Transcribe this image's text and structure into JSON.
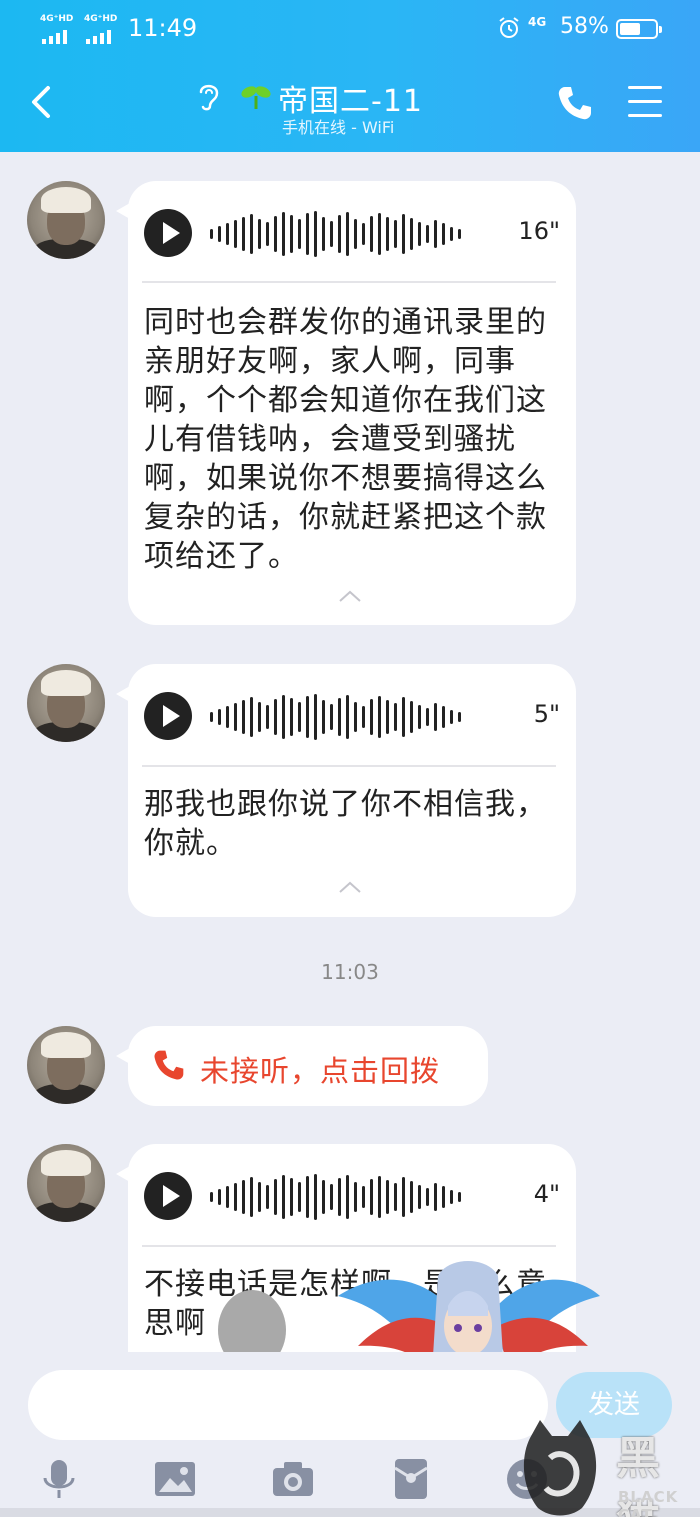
{
  "status_bar": {
    "signal1": "4G⁺HD",
    "signal2": "4G⁺HD",
    "time": "11:49",
    "network": "4G",
    "battery": "58%",
    "battery_level": 0.58
  },
  "header": {
    "title": "帝国二-11",
    "subtitle": "手机在线 - WiFi"
  },
  "messages": [
    {
      "type": "voice",
      "duration": "16\"",
      "transcript": "同时也会群发你的通讯录里的亲朋好友啊，家人啊，同事啊，个个都会知道你在我们这儿有借钱呐，会遭受到骚扰啊，如果说你不想要搞得这么复杂的话，你就赶紧把这个款项给还了。"
    },
    {
      "type": "voice",
      "duration": "5\"",
      "transcript": "那我也跟你说了你不相信我，你就。"
    },
    {
      "type": "timestamp",
      "text": "11:03"
    },
    {
      "type": "missed_call",
      "text": "未接听，点击回拨"
    },
    {
      "type": "voice",
      "duration": "4\"",
      "transcript": "不接电话是怎样啊，是什么意思啊"
    }
  ],
  "input": {
    "placeholder": "",
    "send_label": "发送"
  },
  "toolbar": [
    "microphone-icon",
    "image-icon",
    "camera-icon",
    "red-packet-icon",
    "emoji-icon"
  ],
  "watermark": {
    "cn": "黑猫",
    "en": "BLACK CAT"
  }
}
